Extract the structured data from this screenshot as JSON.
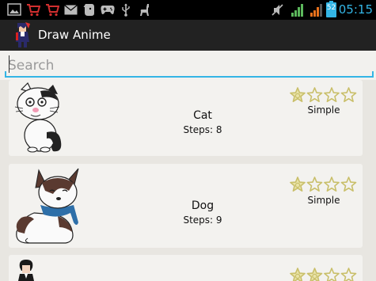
{
  "status_bar": {
    "time": "05:15",
    "battery": "52"
  },
  "action_bar": {
    "title": "Draw Anime"
  },
  "search": {
    "placeholder": "Search"
  },
  "items": [
    {
      "name": "Cat",
      "steps": "Steps: 8",
      "difficulty": "Simple",
      "rating": 1,
      "max_rating": 4
    },
    {
      "name": "Dog",
      "steps": "Steps: 9",
      "difficulty": "Simple",
      "rating": 1,
      "max_rating": 4
    },
    {
      "name": "",
      "steps": "",
      "difficulty": "",
      "rating": 2,
      "max_rating": 4
    }
  ],
  "colors": {
    "accent": "#33b5e5",
    "star_fill": "#e9e3a8",
    "star_stroke": "#c9bf6a"
  }
}
